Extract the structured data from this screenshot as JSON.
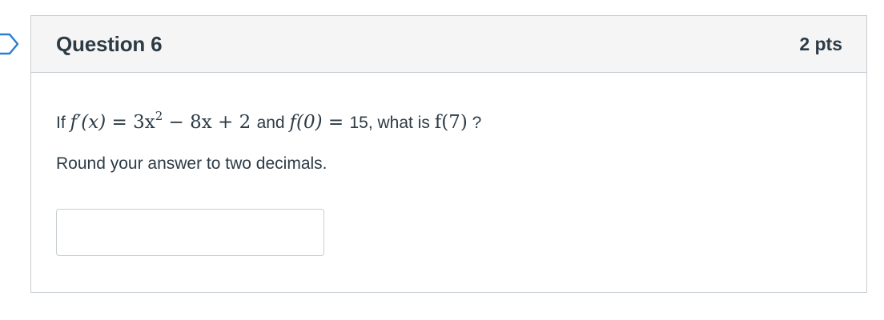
{
  "question": {
    "title": "Question 6",
    "points": "2 pts",
    "text_if": "If",
    "derivative_lhs": "f′(x)",
    "equals": "=",
    "derivative_rhs_term1": "3x",
    "derivative_rhs_exp": "2",
    "derivative_rhs_rest": "− 8x + 2",
    "text_and": "and",
    "initial_lhs": "f(0)",
    "initial_rhs": "15",
    "text_what_is": ", what is",
    "target": "f(7)",
    "question_mark": "?",
    "instruction": "Round your answer to two decimals."
  },
  "answer": {
    "value": "",
    "placeholder": ""
  },
  "icons": {
    "flag": "question-flag-icon"
  }
}
